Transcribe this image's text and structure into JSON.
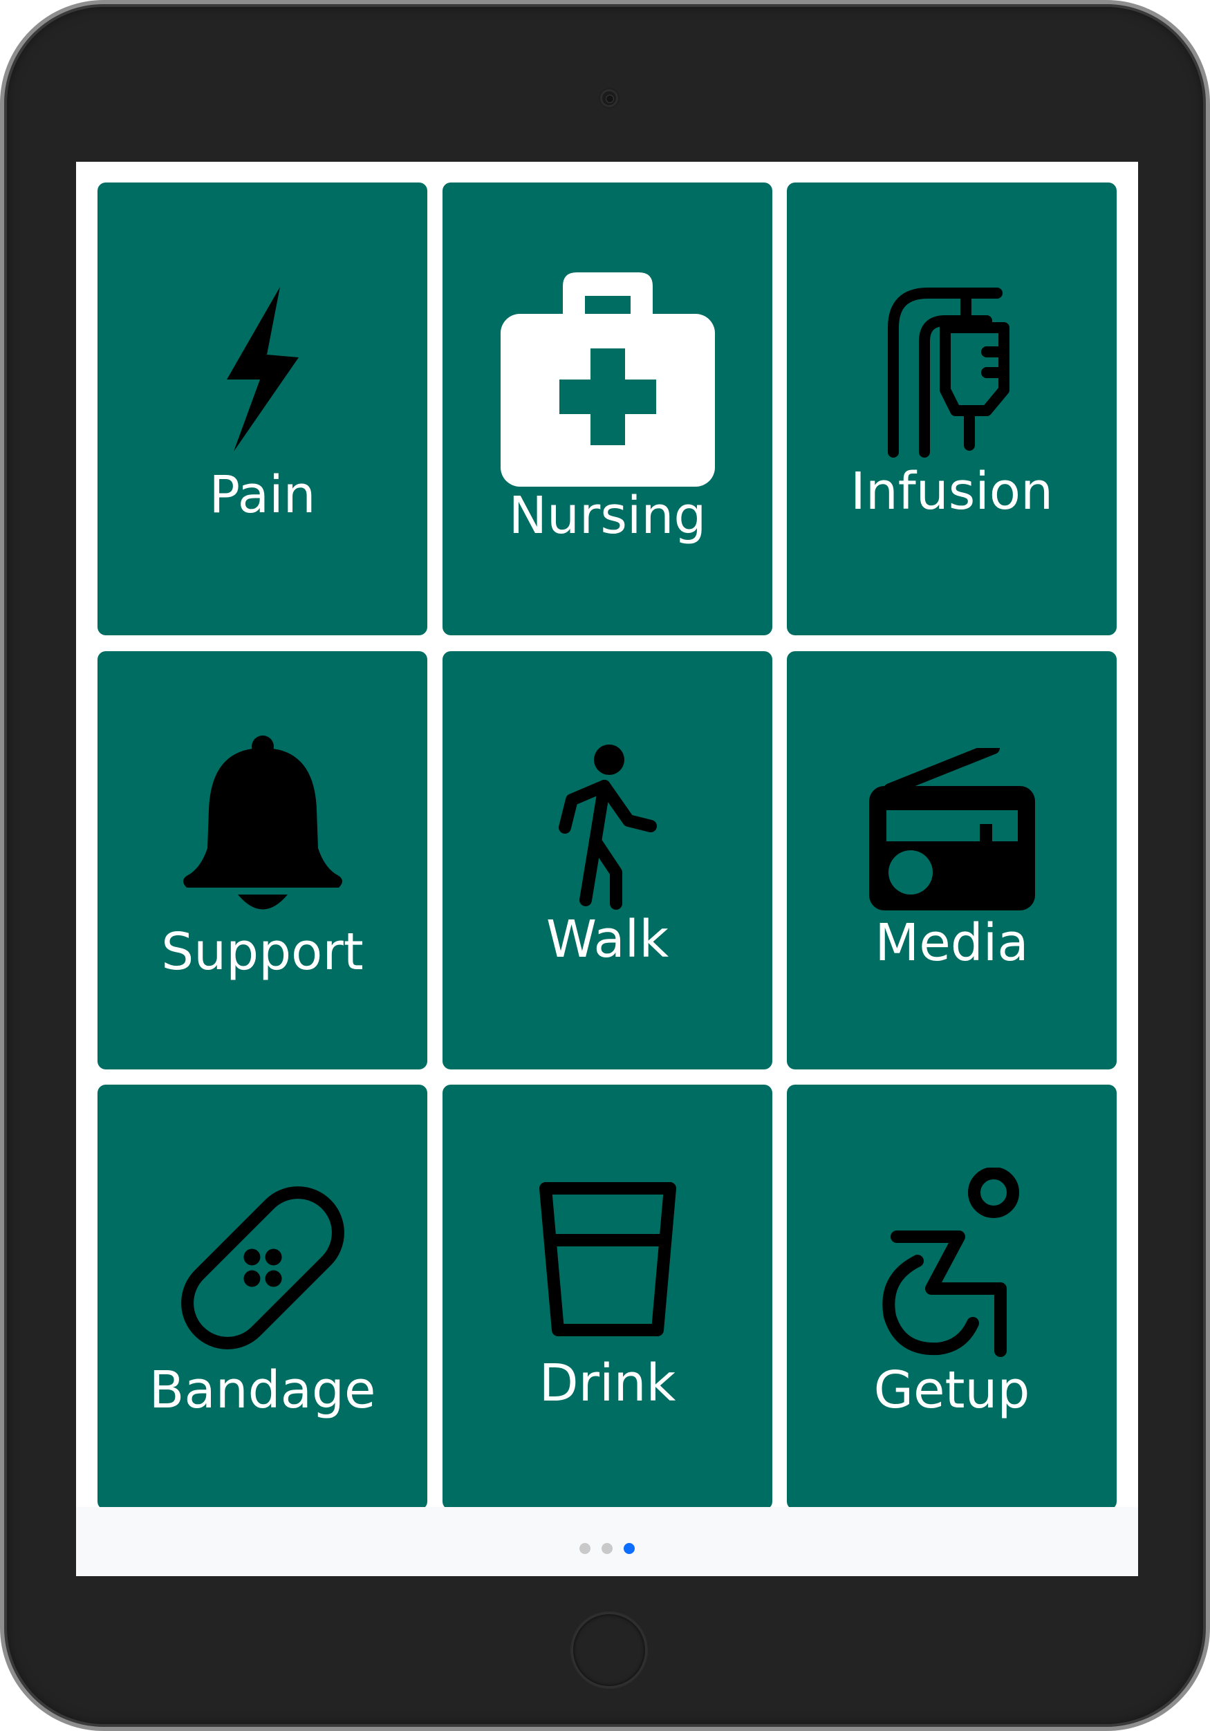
{
  "colors": {
    "tile_background": "#006d62",
    "label_text": "#ffffff",
    "icon_dark": "#000000",
    "active_dot": "#0d6efd",
    "inactive_dot": "#c9c9c9"
  },
  "tiles": [
    {
      "label": "Pain",
      "icon": "lightning-bolt-icon"
    },
    {
      "label": "Nursing",
      "icon": "first-aid-kit-icon"
    },
    {
      "label": "Infusion",
      "icon": "iv-drip-icon"
    },
    {
      "label": "Support",
      "icon": "bell-icon"
    },
    {
      "label": "Walk",
      "icon": "walking-person-icon"
    },
    {
      "label": "Media",
      "icon": "radio-icon"
    },
    {
      "label": "Bandage",
      "icon": "bandage-icon"
    },
    {
      "label": "Drink",
      "icon": "glass-icon"
    },
    {
      "label": "Getup",
      "icon": "wheelchair-icon"
    }
  ],
  "pagination": {
    "page_count": 3,
    "active_page": 3
  }
}
